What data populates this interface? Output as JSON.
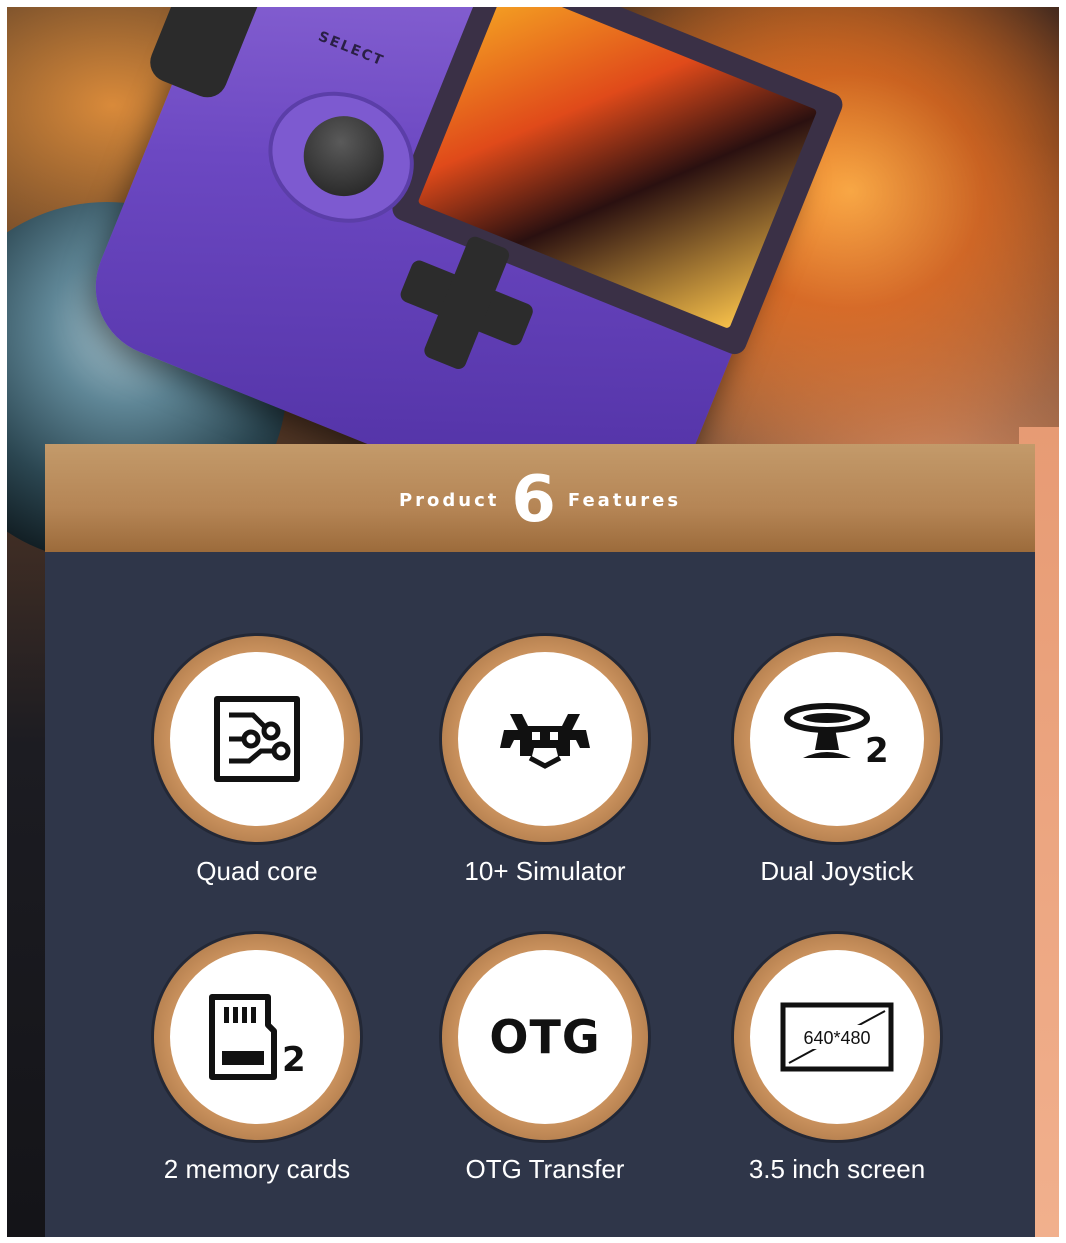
{
  "banner": {
    "word_left": "Product",
    "number": "6",
    "word_right": "Features"
  },
  "device": {
    "select_label": "SELECT"
  },
  "features": [
    {
      "icon": "circuit-chip-icon",
      "label": "Quad core"
    },
    {
      "icon": "retroarch-invader-icon",
      "label": "10+ Simulator"
    },
    {
      "icon": "joystick-icon",
      "label": "Dual Joystick",
      "badge": "2"
    },
    {
      "icon": "memory-card-icon",
      "label": "2 memory cards",
      "badge": "2"
    },
    {
      "icon": "otg-text-icon",
      "label": "OTG Transfer",
      "icon_text": "OTG"
    },
    {
      "icon": "screen-resolution-icon",
      "label": "3.5 inch screen",
      "icon_text": "640*480"
    }
  ],
  "colors": {
    "panel": "#2f3649",
    "banner_gold": "#b58555",
    "ring_gold": "#c9915d",
    "console_purple": "#6c48c2"
  }
}
